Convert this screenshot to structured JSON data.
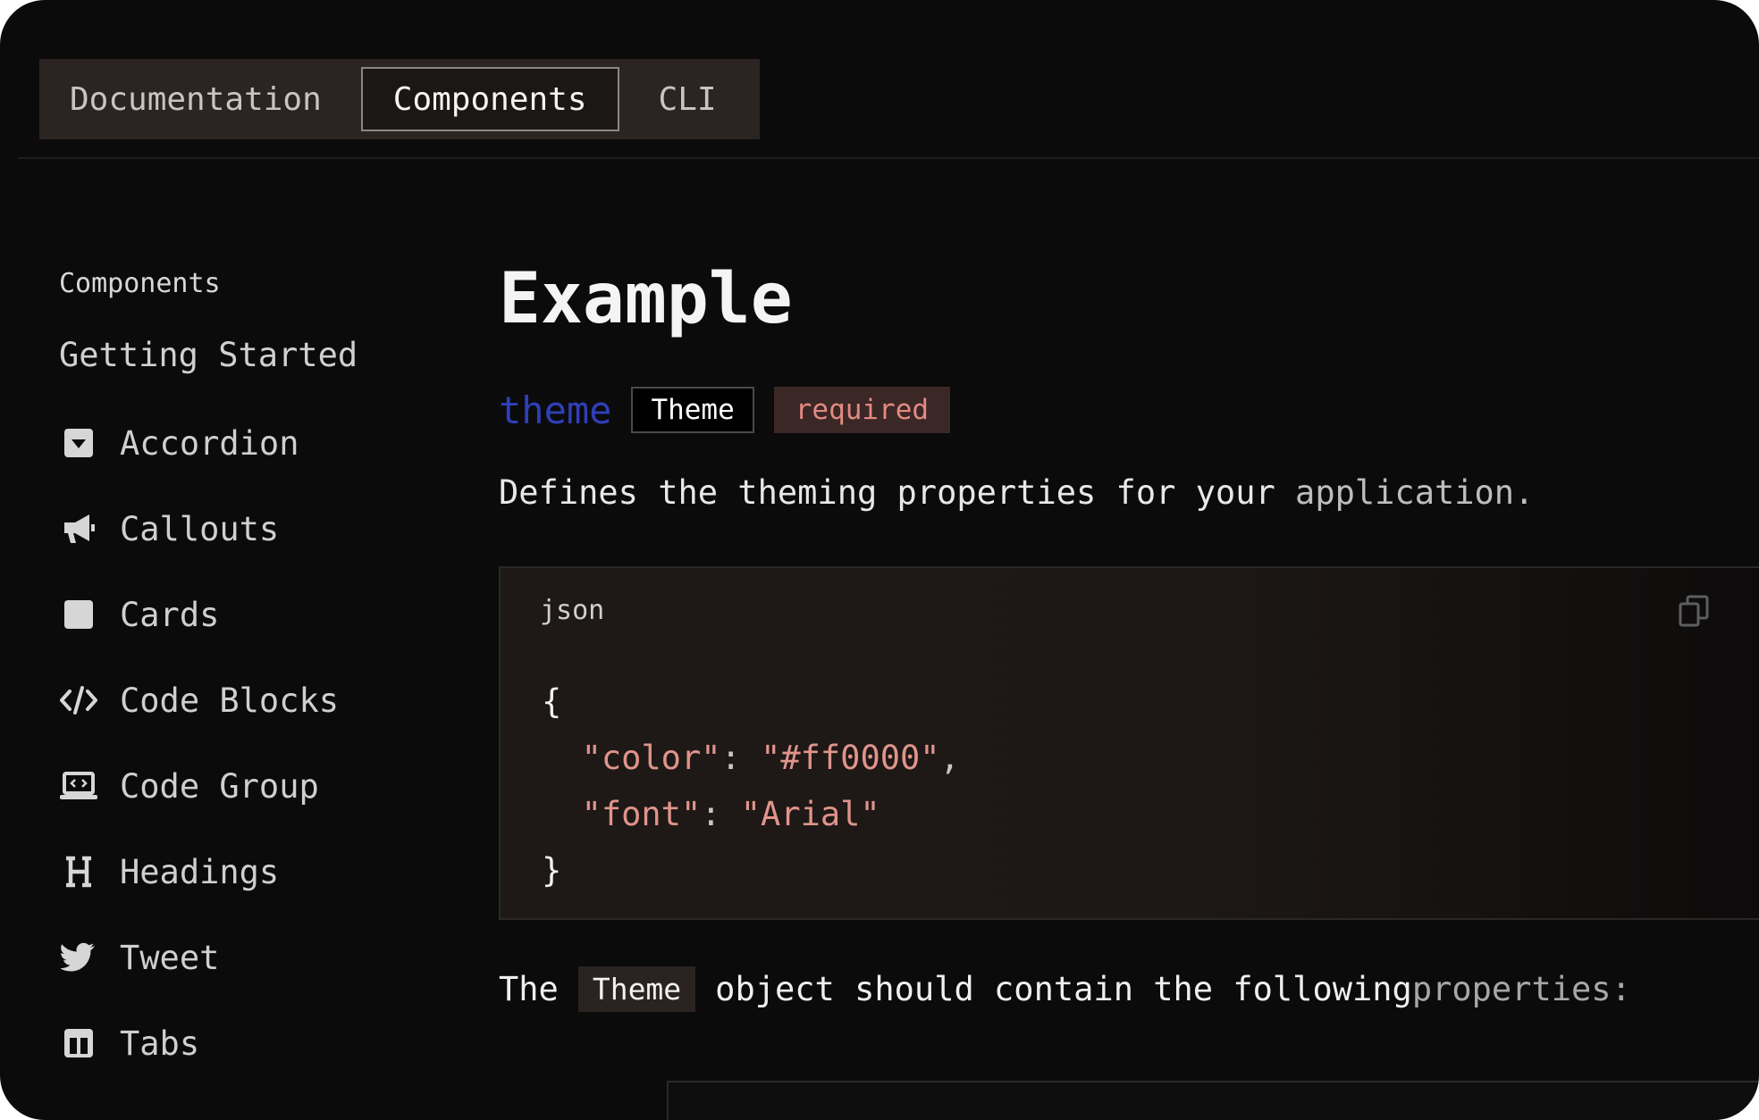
{
  "tabs": [
    {
      "label": "Documentation"
    },
    {
      "label": "Components",
      "active": true
    },
    {
      "label": "CLI"
    }
  ],
  "sidebar": {
    "heading": "Components",
    "getting_started": "Getting Started",
    "items": [
      {
        "label": "Accordion",
        "icon": "caret-square-icon"
      },
      {
        "label": "Callouts",
        "icon": "megaphone-icon"
      },
      {
        "label": "Cards",
        "icon": "square-icon"
      },
      {
        "label": "Code Blocks",
        "icon": "code-icon"
      },
      {
        "label": "Code Group",
        "icon": "laptop-code-icon"
      },
      {
        "label": "Headings",
        "icon": "heading-icon"
      },
      {
        "label": "Tweet",
        "icon": "twitter-icon"
      },
      {
        "label": "Tabs",
        "icon": "columns-icon"
      }
    ]
  },
  "main": {
    "title": "Example",
    "prop": {
      "name": "theme",
      "type": "Theme",
      "required": "required"
    },
    "description_main": "Defines the theming properties for your ",
    "description_fade": "application.",
    "code": {
      "language": "json",
      "open_brace": "{",
      "line1_key": "\"color\"",
      "line1_colon": ": ",
      "line1_value": "\"#ff0000\"",
      "line1_comma": ",",
      "line2_key": "\"font\"",
      "line2_colon": ": ",
      "line2_value": "\"Arial\"",
      "close_brace": "}"
    },
    "bottom": {
      "prefix": "The",
      "inline_code": "Theme",
      "text_main": "object should contain the following ",
      "text_fade": "properties:"
    }
  },
  "colors": {
    "background": "#0b0b0b",
    "prop_name": "#2f3fb8",
    "required_text": "#e38a82",
    "json_string": "#e0948b"
  }
}
